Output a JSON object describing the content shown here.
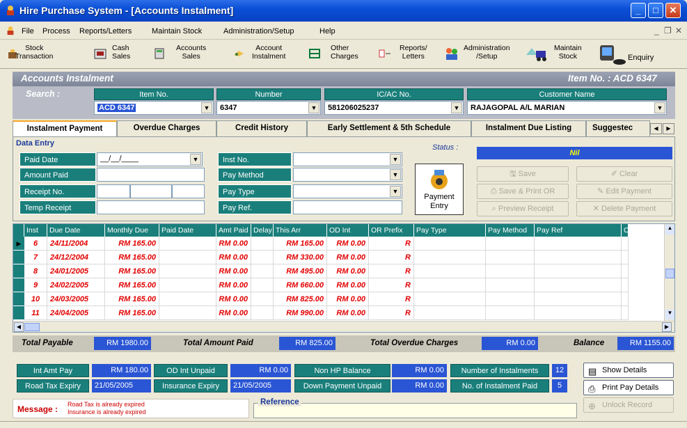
{
  "window": {
    "title": "Hire Purchase System - [Accounts Instalment]"
  },
  "menubar": {
    "items": [
      "File",
      "Process",
      "Reports/Letters",
      "Maintain Stock",
      "Administration/Setup",
      "Help"
    ]
  },
  "toolbar": {
    "stock": [
      "Stock",
      "Transaction"
    ],
    "cash": [
      "Cash",
      "Sales"
    ],
    "accounts": [
      "Accounts",
      "Sales"
    ],
    "account": [
      "Account",
      "Instalment"
    ],
    "other": [
      "Other",
      "Charges"
    ],
    "reports": [
      "Reports/",
      "Letters"
    ],
    "admin": [
      "Administration",
      "/Setup"
    ],
    "maintain": [
      "Maintain",
      "Stock"
    ],
    "enquiry": "Enquiry"
  },
  "header": {
    "title": "Accounts Instalment",
    "item_no": "Item No. : ACD 6347"
  },
  "search": {
    "label": "Search :",
    "item_no_label": "Item No.",
    "item_no": "ACD 6347",
    "number_label": "Number",
    "number": "6347",
    "icac_label": "IC/AC No.",
    "icac": "581206025237",
    "cust_label": "Customer Name",
    "cust": "RAJAGOPAL A/L MARIAN"
  },
  "tabs": [
    "Instalment Payment",
    "Overdue Charges",
    "Credit History",
    "Early Settlement & 5th Schedule",
    "Instalment Due Listing",
    "Suggestec"
  ],
  "entry": {
    "legend": "Data Entry",
    "paid_date": "Paid Date",
    "paid_date_val": "__/__/____",
    "amount_paid": "Amount Paid",
    "receipt_no": "Receipt No.",
    "temp_receipt": "Temp Receipt",
    "inst_no": "Inst No.",
    "pay_method": "Pay Method",
    "pay_type": "Pay Type",
    "pay_ref": "Pay Ref.",
    "status_label": "Status :",
    "status_val": "Nil",
    "payment_entry": [
      "Payment",
      "Entry"
    ],
    "save": "Save",
    "clear": "Clear",
    "save_print": "Save & Print OR",
    "edit_payment": "Edit Payment",
    "preview": "Preview Receipt",
    "delete": "Delete Payment"
  },
  "grid": {
    "columns": [
      "Inst",
      "Due Date",
      "Monthly Due",
      "Paid Date",
      "Amt Paid",
      "Delay",
      "This Arr",
      "OD Int",
      "OR Prefix",
      "Pay Type",
      "Pay Method",
      "Pay Ref",
      "O"
    ],
    "rows": [
      [
        "6",
        "24/11/2004",
        "RM 165.00",
        "",
        "RM 0.00",
        "",
        "RM 165.00",
        "RM 0.00",
        "R"
      ],
      [
        "7",
        "24/12/2004",
        "RM 165.00",
        "",
        "RM 0.00",
        "",
        "RM 330.00",
        "RM 0.00",
        "R"
      ],
      [
        "8",
        "24/01/2005",
        "RM 165.00",
        "",
        "RM 0.00",
        "",
        "RM 495.00",
        "RM 0.00",
        "R"
      ],
      [
        "9",
        "24/02/2005",
        "RM 165.00",
        "",
        "RM 0.00",
        "",
        "RM 660.00",
        "RM 0.00",
        "R"
      ],
      [
        "10",
        "24/03/2005",
        "RM 165.00",
        "",
        "RM 0.00",
        "",
        "RM 825.00",
        "RM 0.00",
        "R"
      ],
      [
        "11",
        "24/04/2005",
        "RM 165.00",
        "",
        "RM 0.00",
        "",
        "RM 990.00",
        "RM 0.00",
        "R"
      ]
    ]
  },
  "totals": {
    "payable_label": "Total Payable",
    "payable": "RM 1980.00",
    "paid_label": "Total Amount Paid",
    "paid": "RM 825.00",
    "overdue_label": "Total Overdue Charges",
    "overdue": "RM 0.00",
    "balance_label": "Balance",
    "balance": "RM 1155.00"
  },
  "bottom": {
    "int_amt_pay": "Int Amt Pay",
    "int_amt_val": "RM 180.00",
    "od_int_unpaid": "OD Int Unpaid",
    "od_int_val": "RM 0.00",
    "non_hp": "Non HP Balance",
    "non_hp_val": "RM 0.00",
    "num_inst": "Number of Instalments",
    "num_inst_val": "12",
    "road_tax": "Road Tax Expiry",
    "road_tax_val": "21/05/2005",
    "insurance": "Insurance Expiry",
    "insurance_val": "21/05/2005",
    "down_payment": "Down Payment Unpaid",
    "down_payment_val": "RM 0.00",
    "inst_paid": "No. of Instalment Paid",
    "inst_paid_val": "5",
    "show_details": "Show Details",
    "print_pay": "Print Pay Details",
    "unlock": "Unlock Record",
    "message_label": "Message :",
    "message_1": "Road Tax is already expired",
    "message_2": "Insurance is already expired",
    "reference": "Reference"
  }
}
